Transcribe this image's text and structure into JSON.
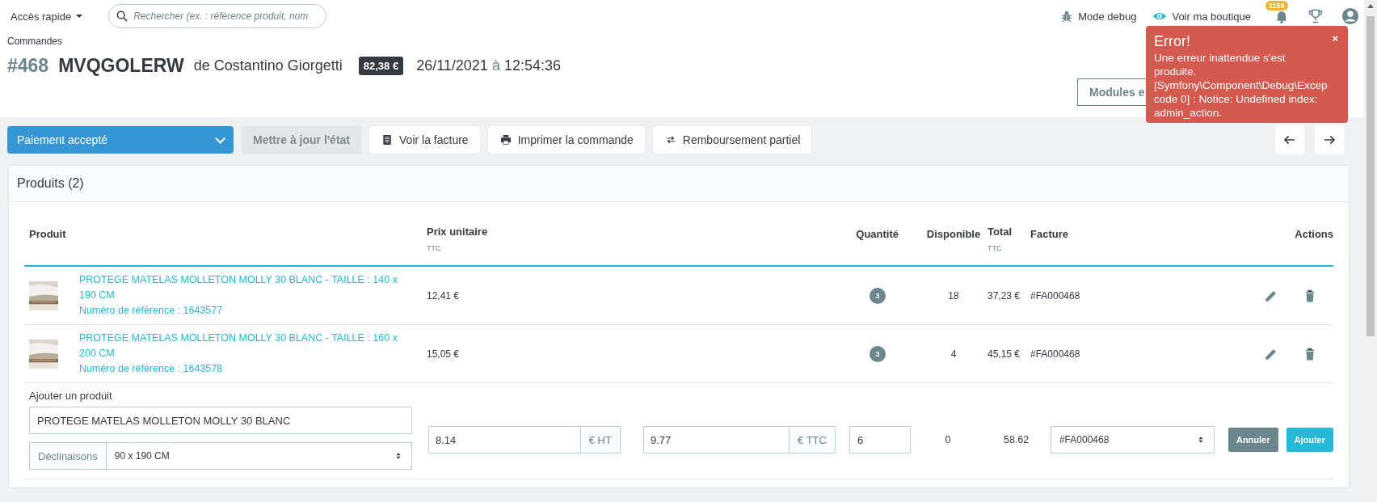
{
  "topbar": {
    "quick_access": "Accès rapide",
    "search": {
      "placeholder": "Rechercher (ex. : référence produit, nom"
    },
    "debug": "Mode debug",
    "shop": "Voir ma boutique",
    "notifications": "1159"
  },
  "breadcrumb": "Commandes",
  "order": {
    "number": "#468",
    "reference": "MVQGOLERW",
    "customer": "de Costantino Giorgetti",
    "total": "82,38 €",
    "date": "26/11/2021",
    "time_sep": "à",
    "time": "12:54:36"
  },
  "header_buttons": [
    {
      "label": "Modules e"
    }
  ],
  "toolbar": {
    "status": "Paiement accepté",
    "buttons": [
      {
        "label": "Mettre à jour l'état",
        "disabled": true,
        "kind": "plain"
      },
      {
        "label": "Voir la facture",
        "disabled": false,
        "kind": "invoice"
      },
      {
        "label": "Imprimer la commande",
        "disabled": false,
        "kind": "print"
      },
      {
        "label": "Remboursement partiel",
        "disabled": false,
        "kind": "exchange"
      }
    ]
  },
  "products": {
    "title": "Produits (2)",
    "columns": [
      {
        "label": "Produit"
      },
      {
        "label": "Prix unitaire",
        "sub": "TTC"
      },
      {
        "label": "Quantité"
      },
      {
        "label": "Disponible"
      },
      {
        "label": "Total",
        "sub": "TTC"
      },
      {
        "label": "Facture"
      },
      {
        "label": "Actions"
      }
    ],
    "rows": [
      {
        "name": "PROTEGE MATELAS MOLLETON MOLLY 30 BLANC - TAILLE : 140 x 190 CM",
        "reference": "Numéro de référence : 1643577",
        "price": "12,41 €",
        "quantity": "3",
        "available": "18",
        "total": "37,23 €",
        "invoice": "#FA000468"
      },
      {
        "name": "PROTEGE MATELAS MOLLETON MOLLY 30 BLANC - TAILLE : 160 x 200 CM",
        "reference": "Numéro de référence : 1643578",
        "price": "15,05 €",
        "quantity": "3",
        "available": "4",
        "total": "45,15 €",
        "invoice": "#FA000468"
      }
    ],
    "add": {
      "label": "Ajouter un produit",
      "product": "PROTEGE MATELAS MOLLETON MOLLY 30 BLANC",
      "combinations_label": "Déclinaisons",
      "combination": "90 x 190 CM",
      "price_ht": "8.14",
      "ht_unit": "€ HT",
      "price_ttc": "9.77",
      "ttc_unit": "€ TTC",
      "quantity": "6",
      "available": "0",
      "total": "58.62",
      "invoice": "#FA000468",
      "cancel": "Annuler",
      "submit": "Ajouter"
    }
  },
  "toast": {
    "title": "Error!",
    "message": "Une erreur inattendue s'est\nproduite.\n[Symfony\\Component\\Debug\\Excep\ncode 0] : Notice: Undefined index:\nadmin_action.",
    "close": "×"
  }
}
